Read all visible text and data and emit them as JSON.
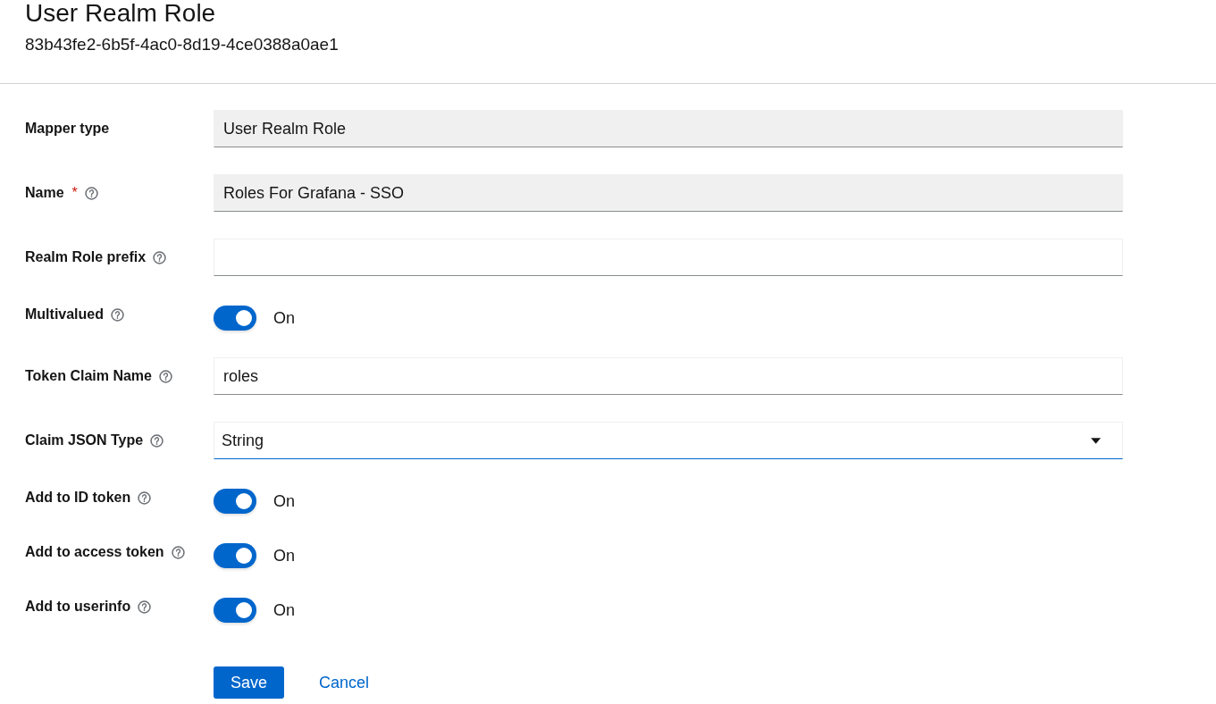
{
  "header": {
    "title": "User Realm Role",
    "subtitle": "83b43fe2-6b5f-4ac0-8d19-4ce0388a0ae1"
  },
  "form": {
    "rows": [
      {
        "kind": "text",
        "label": "Mapper type",
        "help": false,
        "value": "User Realm Role",
        "readonly": true,
        "focused": false
      },
      {
        "kind": "text",
        "label": "Name",
        "required_mark": "*",
        "help": true,
        "value": "Roles For Grafana - SSO",
        "readonly": true,
        "focused": false
      },
      {
        "kind": "text",
        "label": "Realm Role prefix",
        "help": true,
        "readonly": false,
        "focused": false
      },
      {
        "kind": "toggle",
        "label": "Multivalued",
        "help": true,
        "on": true,
        "state_label": "On"
      },
      {
        "kind": "text",
        "label": "Token Claim Name",
        "help": true,
        "value": "roles",
        "readonly": false,
        "focused": false
      },
      {
        "kind": "select",
        "label": "Claim JSON Type",
        "help": true,
        "value": "String",
        "focused": true
      },
      {
        "kind": "toggle",
        "label": "Add to ID token",
        "help": true,
        "on": true,
        "state_label": "On"
      },
      {
        "kind": "toggle",
        "label": "Add to access token",
        "help": true,
        "on": true,
        "state_label": "On"
      },
      {
        "kind": "toggle",
        "label": "Add to userinfo",
        "help": true,
        "on": true,
        "state_label": "On"
      }
    ]
  },
  "actions": [
    {
      "kind": "primary",
      "label": "Save"
    },
    {
      "kind": "link",
      "label": "Cancel"
    }
  ]
}
